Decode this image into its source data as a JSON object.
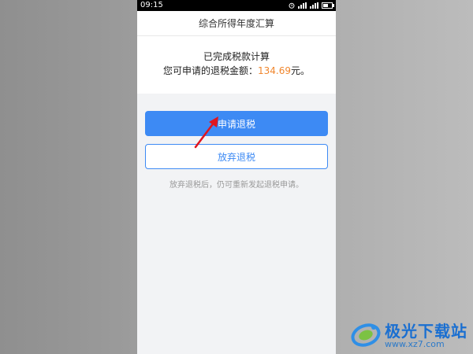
{
  "statusbar": {
    "time": "09:15"
  },
  "nav": {
    "title": "综合所得年度汇算"
  },
  "result": {
    "status": "已完成税款计算",
    "refund_prefix": "您可申请的退税金额：",
    "refund_amount": "134.69",
    "refund_suffix": "元。"
  },
  "actions": {
    "apply_label": "申请退税",
    "abandon_label": "放弃退税",
    "hint": "放弃退税后，仍可重新发起退税申请。"
  },
  "watermark": {
    "title": "极光下载站",
    "url": "www.xz7.com"
  },
  "colors": {
    "primary": "#3d8af4",
    "amount": "#f0862d",
    "arrow": "#e0151f"
  }
}
